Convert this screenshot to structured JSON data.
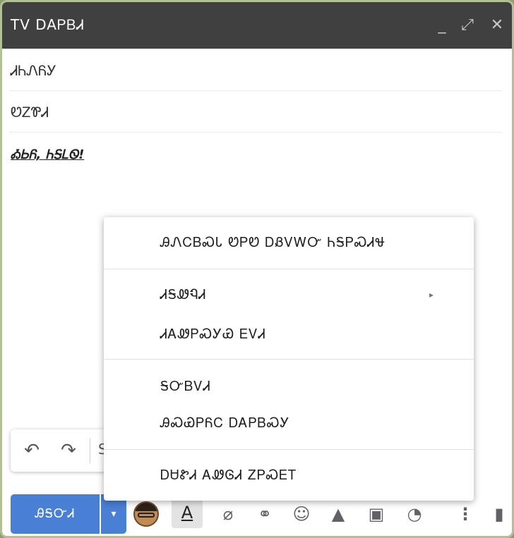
{
  "window": {
    "title": "TV DAᏢᏴᏗ",
    "minimize_label": "_",
    "expand_label": "⤢",
    "close_label": "✕"
  },
  "compose": {
    "to_value": "ᏗᏂᏁᏲᎩ",
    "subject_value": "ᏬᏃᏈᏗ",
    "body_text": "ᎣᏏᏲ, ᏂᎦᏞᏫ!"
  },
  "format_toolbar": {
    "undo_icon": "undo-icon",
    "redo_icon": "redo-icon",
    "more_label": "S"
  },
  "context_menu": {
    "items": [
      {
        "label": "ᎯᏁᏟᏴᏍᏓ ᏬᏢᏬ ᎠᏰᏙᎳᏅ ᏂᎦᏢᏍᏗᏠ",
        "has_submenu": false
      },
      {
        "label": "ᏗᎦᏪᏄᏗ",
        "has_submenu": true
      },
      {
        "label": "ᏗᎪᏪᏢᏍᎩᏯ ᎬᏙᏗ",
        "has_submenu": false
      },
      {
        "label": "ᎦᏅᏴᏙᏗ",
        "has_submenu": false
      },
      {
        "label": "ᎯᏍᏯᏢᏲᏟ ᎠᎪᏢᏴᏍᎩ",
        "has_submenu": false
      },
      {
        "label": "ᎠᏌᏑᏗ ᎪᏪᎶᏗ ᏃᏢᏍᎬᎢ",
        "has_submenu": false
      }
    ],
    "submenu_arrow": "▸"
  },
  "bottom_toolbar": {
    "send_label": "ᎯᎦᏅᏗ",
    "send_options_arrow": "▾",
    "format_label": "A",
    "attach_icon": "⌀",
    "link_icon": "⚭",
    "emoji_icon": "☺",
    "drive_icon": "▲",
    "photo_icon": "▣",
    "lock_icon": "◔",
    "more_icon": "⋮",
    "trash_icon": "▮"
  }
}
